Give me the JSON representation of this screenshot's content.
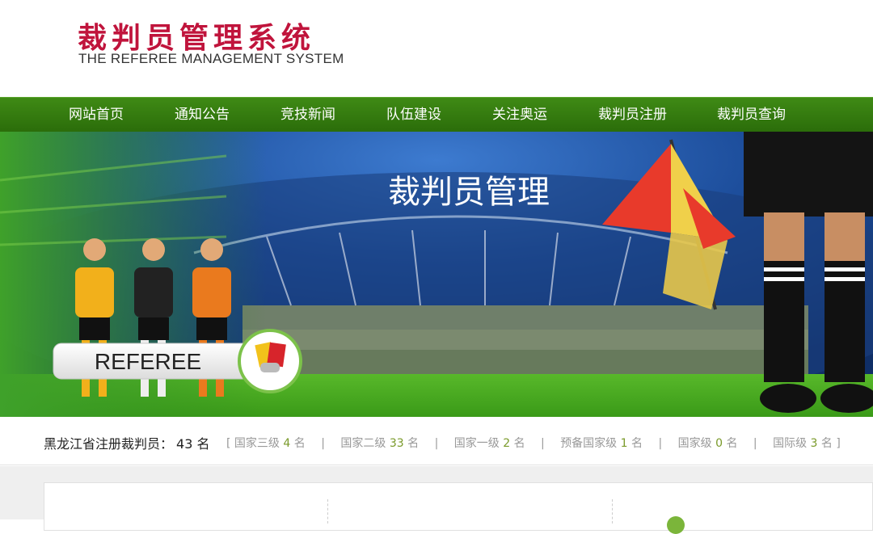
{
  "header": {
    "logo_cn": "裁判员管理系统",
    "logo_en": "THE REFEREE MANAGEMENT SYSTEM"
  },
  "nav": {
    "items": [
      {
        "label": "网站首页"
      },
      {
        "label": "通知公告"
      },
      {
        "label": "竞技新闻"
      },
      {
        "label": "队伍建设"
      },
      {
        "label": "关注奥运"
      },
      {
        "label": "裁判员注册"
      },
      {
        "label": "裁判员查询"
      }
    ]
  },
  "banner": {
    "title": "裁判员管理",
    "badge": "REFEREE"
  },
  "stats": {
    "label": "黑龙江省注册裁判员：",
    "total": "43 名",
    "open_bracket": "[",
    "close_bracket": "]",
    "separator": "|",
    "levels": [
      {
        "name": "国家三级",
        "count": "4",
        "unit": "名"
      },
      {
        "name": "国家二级",
        "count": "33",
        "unit": "名"
      },
      {
        "name": "国家一级",
        "count": "2",
        "unit": "名"
      },
      {
        "name": "预备国家级",
        "count": "1",
        "unit": "名"
      },
      {
        "name": "国家级",
        "count": "0",
        "unit": "名"
      },
      {
        "name": "国际级",
        "count": "3",
        "unit": "名"
      }
    ]
  },
  "colors": {
    "brand_red": "#c0143c",
    "nav_green": "#2e700c",
    "count_green": "#7a9a2a"
  }
}
